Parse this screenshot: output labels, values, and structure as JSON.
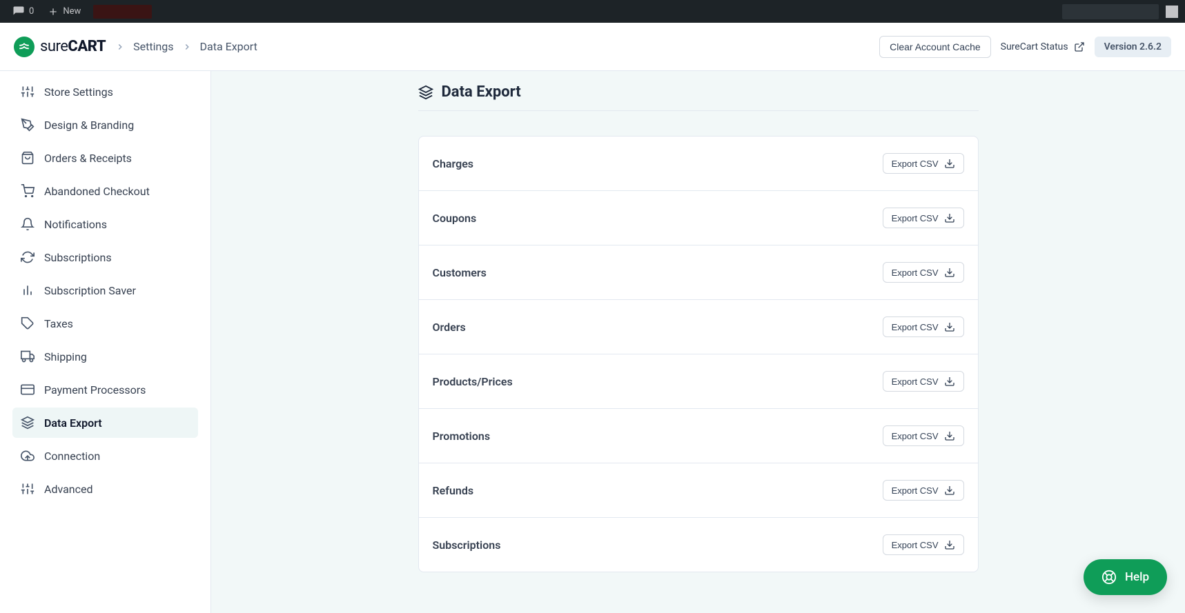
{
  "wp_toolbar": {
    "comments_count": "0",
    "new_label": "New"
  },
  "brand": {
    "name_light": "sure",
    "name_bold": "CART"
  },
  "breadcrumb": {
    "level1": "Settings",
    "level2": "Data Export"
  },
  "topbar": {
    "clear_cache_label": "Clear Account Cache",
    "status_label": "SureCart Status",
    "version_label": "Version 2.6.2"
  },
  "sidebar": {
    "items": [
      {
        "label": "Store Settings",
        "icon": "sliders-icon"
      },
      {
        "label": "Design & Branding",
        "icon": "pen-icon"
      },
      {
        "label": "Orders & Receipts",
        "icon": "bag-icon"
      },
      {
        "label": "Abandoned Checkout",
        "icon": "cart-icon"
      },
      {
        "label": "Notifications",
        "icon": "bell-icon"
      },
      {
        "label": "Subscriptions",
        "icon": "refresh-icon"
      },
      {
        "label": "Subscription Saver",
        "icon": "bars-icon"
      },
      {
        "label": "Taxes",
        "icon": "tag-icon"
      },
      {
        "label": "Shipping",
        "icon": "truck-icon"
      },
      {
        "label": "Payment Processors",
        "icon": "card-icon"
      },
      {
        "label": "Data Export",
        "icon": "layers-icon"
      },
      {
        "label": "Connection",
        "icon": "cloud-icon"
      },
      {
        "label": "Advanced",
        "icon": "sliders-icon"
      }
    ],
    "active_index": 10
  },
  "page": {
    "title": "Data Export",
    "export_button_label": "Export CSV",
    "rows": [
      {
        "label": "Charges"
      },
      {
        "label": "Coupons"
      },
      {
        "label": "Customers"
      },
      {
        "label": "Orders"
      },
      {
        "label": "Products/Prices"
      },
      {
        "label": "Promotions"
      },
      {
        "label": "Refunds"
      },
      {
        "label": "Subscriptions"
      }
    ]
  },
  "help_fab": {
    "label": "Help"
  }
}
